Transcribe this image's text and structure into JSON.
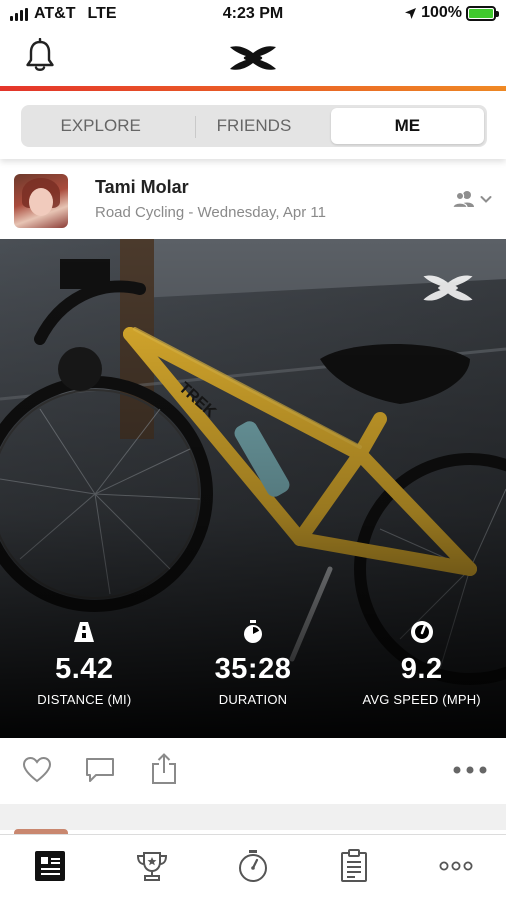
{
  "status_bar": {
    "carrier": "AT&T",
    "network": "LTE",
    "time": "4:23 PM",
    "battery_percent": "100%"
  },
  "colors": {
    "accent_start": "#e5352b",
    "accent_end": "#f08a25",
    "battery_green": "#3fc92c"
  },
  "tabs": [
    {
      "label": "EXPLORE",
      "active": false
    },
    {
      "label": "FRIENDS",
      "active": false
    },
    {
      "label": "ME",
      "active": true
    }
  ],
  "post": {
    "user_name": "Tami Molar",
    "activity_line": "Road Cycling - Wednesday, Apr 11",
    "photo_alt": "yellow TREK bicycle",
    "stats": [
      {
        "icon": "road-icon",
        "value": "5.42",
        "label": "DISTANCE (MI)"
      },
      {
        "icon": "stopwatch-icon",
        "value": "35:28",
        "label": "DURATION"
      },
      {
        "icon": "speedometer-icon",
        "value": "9.2",
        "label": "AVG SPEED (MPH)"
      }
    ]
  },
  "icons": {
    "header_left": "bell-icon",
    "header_center": "under-armour-logo",
    "privacy": "friends-privacy-icon",
    "actions": [
      "heart-icon",
      "comment-icon",
      "share-icon",
      "more-icon"
    ],
    "bottom_nav": [
      "feed-icon",
      "challenges-trophy-icon",
      "record-stopwatch-icon",
      "log-clipboard-icon",
      "more-icon"
    ]
  }
}
